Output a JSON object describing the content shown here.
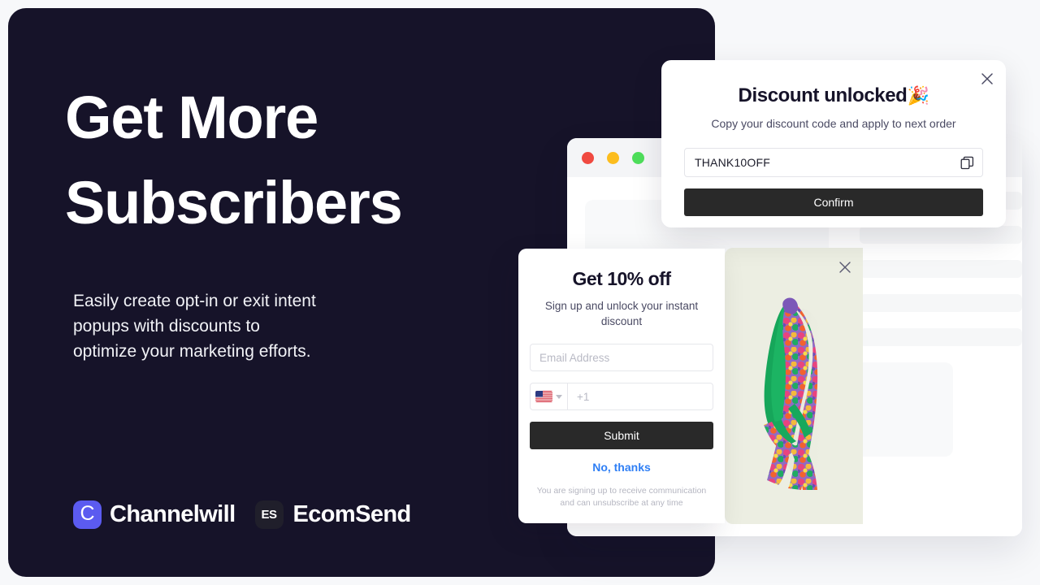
{
  "hero": {
    "title_lines": [
      "Get More",
      "Subscribers"
    ],
    "subtitle_lines": [
      "Easily create opt-in or exit intent",
      "popups with discounts to",
      "optimize your marketing efforts."
    ],
    "background_color": "#161329"
  },
  "brands": [
    {
      "mark_glyph": "C",
      "name": "Channelwill",
      "mark_color": "#5B5BF0",
      "icon": "channelwill-logo-icon"
    },
    {
      "mark_glyph": "ES",
      "name": "EcomSend",
      "mark_color": "#201F2B",
      "icon": "ecomsend-logo-icon"
    }
  ],
  "browser": {
    "traffic_lights": [
      {
        "name": "close",
        "color": "#F04A41"
      },
      {
        "name": "minimize",
        "color": "#FCBD1E"
      },
      {
        "name": "maximize",
        "color": "#4EDE5B"
      }
    ]
  },
  "discount_popup": {
    "title": "Discount unlocked",
    "title_emoji": "🎉",
    "subtitle": "Copy your discount code and apply to next order",
    "code_value": "THANK10OFF",
    "copy_icon": "copy-icon",
    "close_icon": "close-icon",
    "confirm_label": "Confirm",
    "button_color": "#292929"
  },
  "signup_popup": {
    "title": "Get 10% off",
    "subtitle": "Sign up and unlock your instant discount",
    "email_placeholder": "Email Address",
    "phone_placeholder": "+1",
    "country_flag": "us-flag-icon",
    "submit_label": "Submit",
    "decline_label": "No, thanks",
    "decline_color": "#2F7FF5",
    "fineprint": "You are signing up to receive communication and can unsubscribe at any time",
    "button_color": "#292929"
  },
  "product_panel": {
    "close_icon": "close-icon",
    "background_color": "#ECEEE2",
    "image_alt": "hanging-floral-jacket"
  }
}
